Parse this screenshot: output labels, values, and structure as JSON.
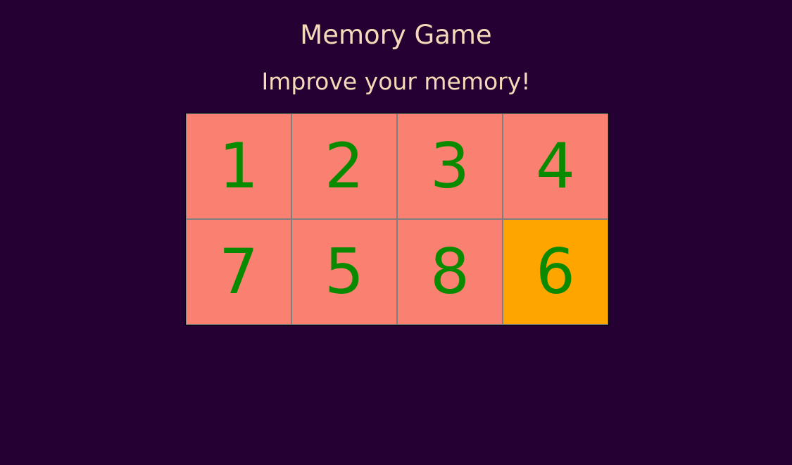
{
  "header": {
    "title": "Memory Game",
    "subtitle": "Improve your memory!"
  },
  "board": {
    "cards": [
      {
        "label": "1",
        "highlighted": false
      },
      {
        "label": "2",
        "highlighted": false
      },
      {
        "label": "3",
        "highlighted": false
      },
      {
        "label": "4",
        "highlighted": false
      },
      {
        "label": "7",
        "highlighted": false
      },
      {
        "label": "5",
        "highlighted": false
      },
      {
        "label": "8",
        "highlighted": false
      },
      {
        "label": "6",
        "highlighted": true
      }
    ]
  },
  "colors": {
    "background": "#240033",
    "text": "#f5d9b8",
    "card": "#fa8072",
    "card_highlighted": "#ffa500",
    "card_number": "#0a8a00"
  }
}
